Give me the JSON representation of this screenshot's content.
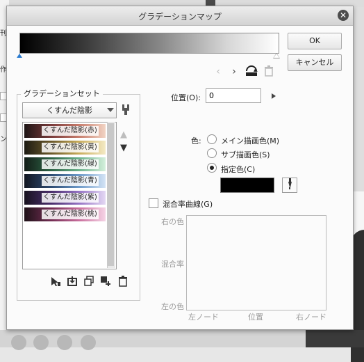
{
  "dialog": {
    "title": "グラデーションマップ",
    "ok_label": "OK",
    "cancel_label": "キャンセル"
  },
  "gradient_set": {
    "group_label": "グラデーションセット",
    "selected_set": "くすんだ陰影",
    "items": [
      {
        "label": "くすんだ陰影(赤)",
        "colors": [
          "#1e1616",
          "#7a3a3a",
          "#c77a6a",
          "#f2d4c4"
        ]
      },
      {
        "label": "くすんだ陰影(黄)",
        "colors": [
          "#1c1a12",
          "#6c5a2a",
          "#c8ac5a",
          "#f4eac4"
        ]
      },
      {
        "label": "くすんだ陰影(緑)",
        "colors": [
          "#121c16",
          "#2e6446",
          "#6ab08a",
          "#d4f0dc"
        ]
      },
      {
        "label": "くすんだ陰影(青)",
        "colors": [
          "#121620",
          "#2e4c74",
          "#6a98c8",
          "#d4e4f6"
        ]
      },
      {
        "label": "くすんだ陰影(紫)",
        "colors": [
          "#17121e",
          "#4a2e6c",
          "#9472c4",
          "#e4d8f4"
        ]
      },
      {
        "label": "くすんだ陰影(桃)",
        "colors": [
          "#1e1218",
          "#742e54",
          "#c86e9c",
          "#f6d4e6"
        ]
      }
    ]
  },
  "node_settings": {
    "position_label": "位置(O):",
    "position_value": "0",
    "color_label": "色:",
    "radio_main": "メイン描画色(M)",
    "radio_sub": "サブ描画色(S)",
    "radio_specified": "指定色(C)",
    "selected_radio": "specified",
    "specified_color": "#000000"
  },
  "blend_curve": {
    "checkbox_label": "混合率曲線(G)",
    "checked": false,
    "y_top": "右の色",
    "y_mid": "混合率",
    "y_bottom": "左の色",
    "x_left": "左ノード",
    "x_mid": "位置",
    "x_right": "右ノード"
  },
  "background": {
    "left_fragments": [
      "0",
      "刊",
      "作",
      "",
      "",
      "ン",
      "0",
      ""
    ]
  }
}
